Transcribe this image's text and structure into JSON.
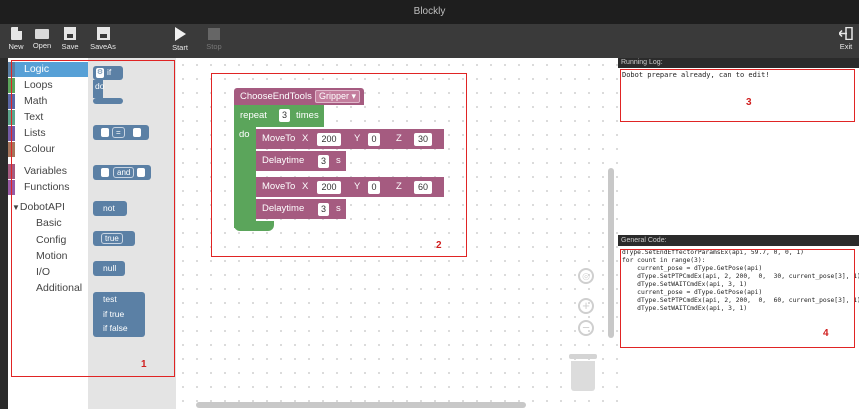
{
  "window": {
    "title": "Blockly"
  },
  "toolbar": {
    "new_label": "New",
    "open_label": "Open",
    "save_label": "Save",
    "saveas_label": "SaveAs",
    "start_label": "Start",
    "stop_label": "Stop",
    "exit_label": "Exit"
  },
  "categories": {
    "logic": "Logic",
    "loops": "Loops",
    "math": "Math",
    "text": "Text",
    "lists": "Lists",
    "colour": "Colour",
    "variables": "Variables",
    "functions": "Functions",
    "dobotapi": "DobotAPI",
    "basic": "Basic",
    "config": "Config",
    "motion": "Motion",
    "io": "I/O",
    "additional": "Additional",
    "colors": {
      "logic": "#5b80a5",
      "loops": "#5ba55b",
      "math": "#5b67a5",
      "text": "#5ba58c",
      "lists": "#745ba5",
      "colour": "#a5745b",
      "variables": "#a55b80",
      "functions": "#995ba5",
      "dobot": "#a55b80"
    }
  },
  "flyout": {
    "if_label": "if",
    "do_label": "do",
    "eq_label": "=",
    "and_label": "and",
    "not_label": "not",
    "true_label": "true",
    "null_label": "null",
    "test_label": "test",
    "iftrue_label": "if true",
    "iffalse_label": "if false"
  },
  "workspace": {
    "choose_label": "ChooseEndTools",
    "gripper_label": "Gripper",
    "repeat_label": "repeat",
    "repeat_count": "3",
    "times_label": "times",
    "do_label": "do",
    "move1": {
      "label": "MoveTo",
      "x_label": "X",
      "x": "200",
      "y_label": "Y",
      "y": "0",
      "z_label": "Z",
      "z": "30"
    },
    "delay1": {
      "label": "Delaytime",
      "value": "3",
      "unit": "s"
    },
    "move2": {
      "label": "MoveTo",
      "x_label": "X",
      "x": "200",
      "y_label": "Y",
      "y": "0",
      "z_label": "Z",
      "z": "60"
    },
    "delay2": {
      "label": "Delaytime",
      "value": "3",
      "unit": "s"
    }
  },
  "log": {
    "title": "Running Log:",
    "text": "Dobot prepare already, can to edit!"
  },
  "code": {
    "title": "General Code:",
    "lines": [
      "dType.SetEndEffectorParamsEx(api, 59.7, 0, 0, 1)",
      "for count in range(3):",
      "    current_pose = dType.GetPose(api)",
      "    dType.SetPTPCmdEx(api, 2, 200,  0,  30, current_pose[3], 1)",
      "    dType.SetWAITCmdEx(api, 3, 1)",
      "    current_pose = dType.GetPose(api)",
      "    dType.SetPTPCmdEx(api, 2, 200,  0,  60, current_pose[3], 1)",
      "    dType.SetWAITCmdEx(api, 3, 1)"
    ]
  },
  "annotations": {
    "one": "1",
    "two": "2",
    "three": "3",
    "four": "4"
  },
  "accent": {
    "annotation_red": "#e02424",
    "selected_blue": "#57a0d6"
  }
}
